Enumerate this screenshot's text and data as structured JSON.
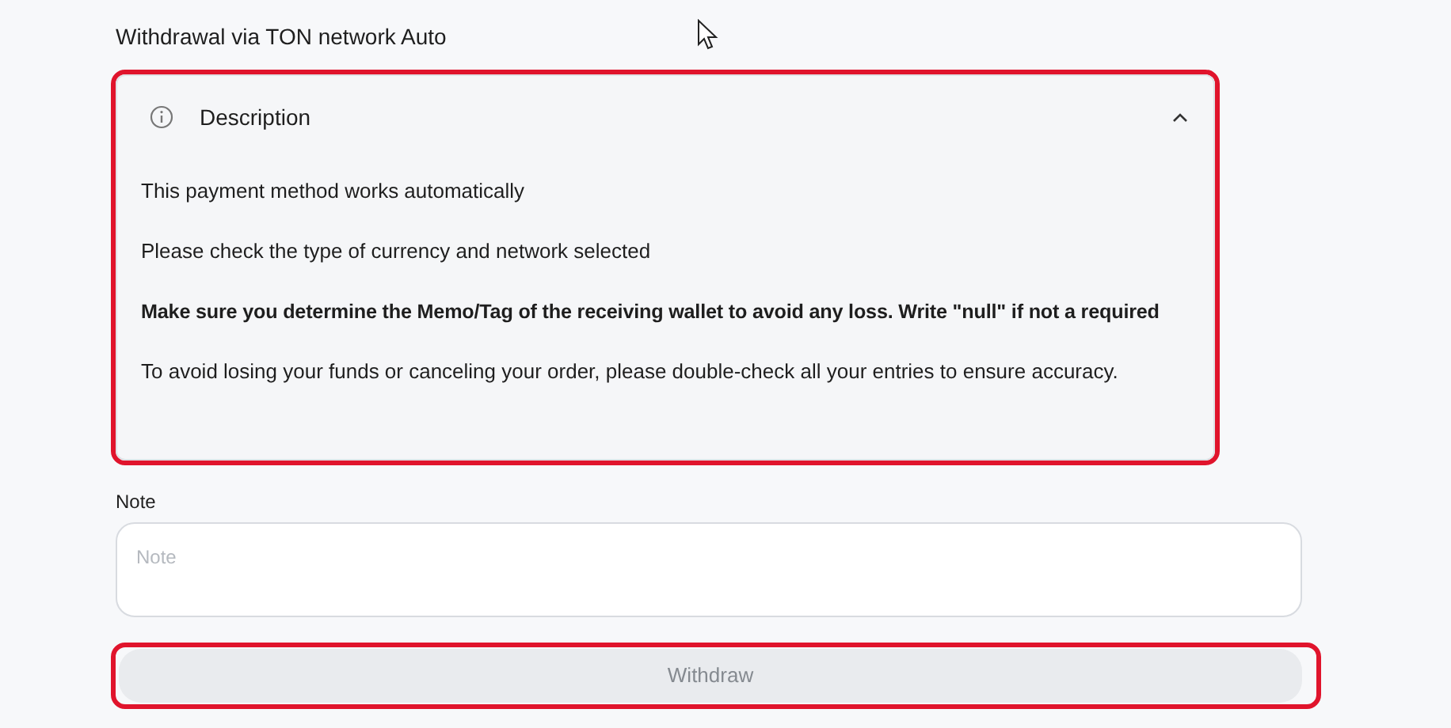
{
  "title": "Withdrawal via TON network Auto",
  "description": {
    "heading": "Description",
    "expanded": true,
    "highlighted": true,
    "paragraphs": [
      {
        "text": "This payment method works automatically",
        "bold": false
      },
      {
        "text": "Please check the type of currency and network selected",
        "bold": false
      },
      {
        "text": "Make sure you determine the Memo/Tag of the receiving wallet to avoid any loss. Write \"null\" if not a required",
        "bold": true
      },
      {
        "text": "To avoid losing your funds or canceling your order, please double-check all your entries to ensure accuracy.",
        "bold": false
      }
    ]
  },
  "note": {
    "label": "Note",
    "placeholder": "Note"
  },
  "withdraw_button": {
    "label": "Withdraw",
    "disabled": true,
    "highlighted": true
  }
}
